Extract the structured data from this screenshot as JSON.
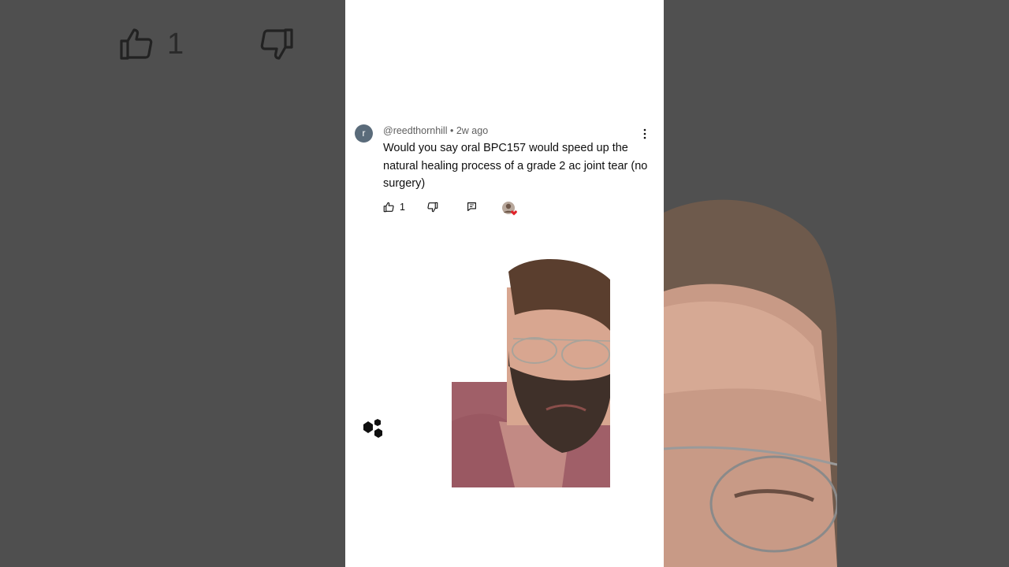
{
  "background": {
    "like_count": "1"
  },
  "comment": {
    "avatar_letter": "r",
    "handle": "@reedthornhill",
    "separator": "•",
    "age": "2w ago",
    "text": "Would you say oral BPC157 would speed up the natural healing process of a grade 2 ac joint tear (no surgery)",
    "like_count": "1"
  },
  "icons": {
    "like": "thumbs-up-icon",
    "dislike": "thumbs-down-icon",
    "reply": "reply-icon",
    "more": "more-vert-icon",
    "logo": "hexagon-logo-icon"
  },
  "colors": {
    "panel": "#ffffff",
    "backdrop": "#525252",
    "heart": "#e0242b",
    "avatar": "#5a6b7a"
  }
}
